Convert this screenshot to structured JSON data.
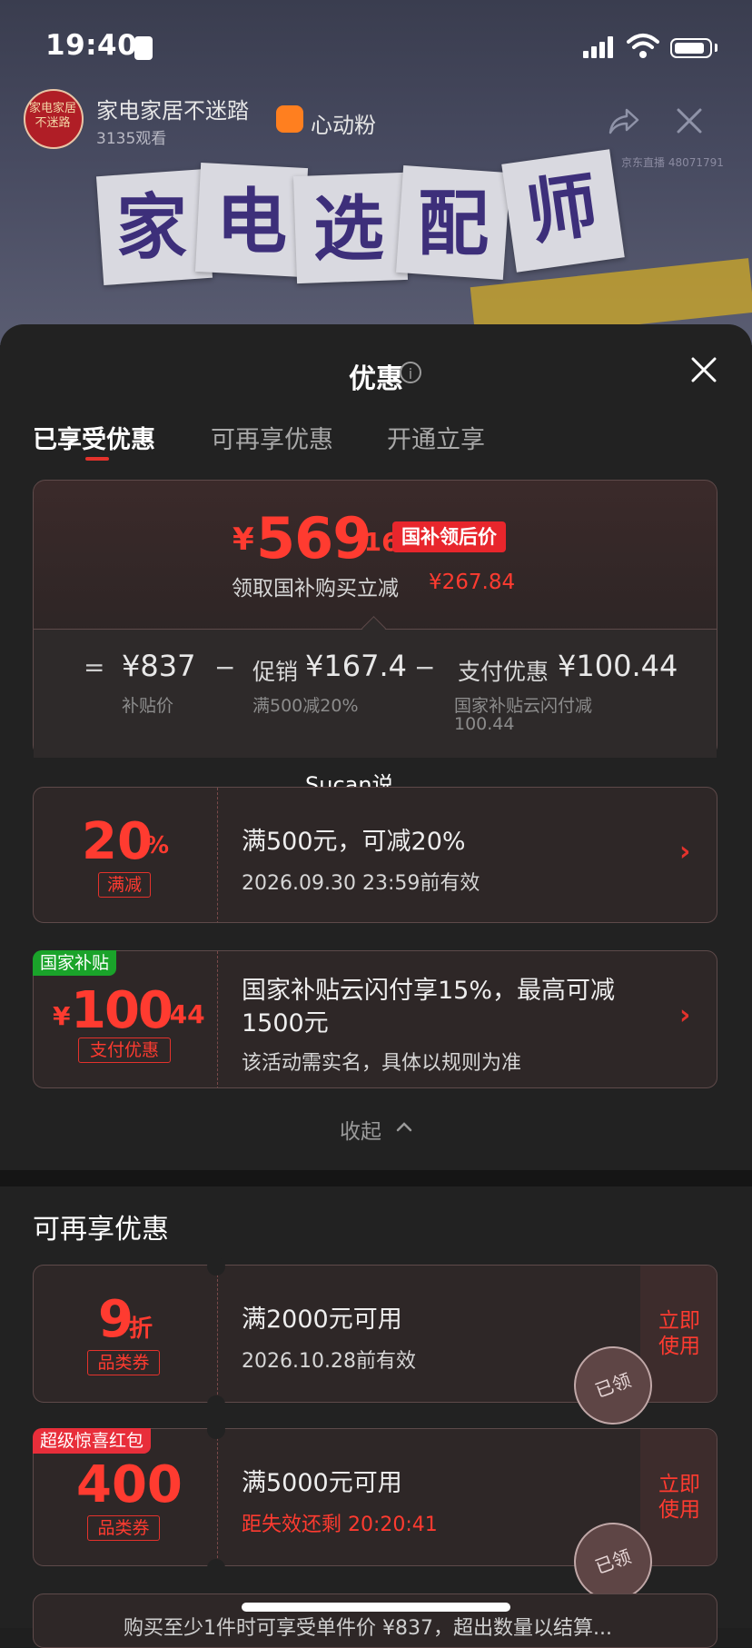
{
  "status_bar": {
    "time": "19:40"
  },
  "live": {
    "avatar_text": "家电家居\n不迷路",
    "name": "家电家居不迷踏",
    "views": "3135观看",
    "fans_label": "心动粉",
    "room_no": "京东直播 48071791",
    "banner_chars": [
      "家",
      "电",
      "选",
      "配",
      "师"
    ]
  },
  "sheet": {
    "title": "优惠",
    "tabs": [
      "已享受优惠",
      "可再享优惠",
      "开通立享"
    ],
    "active_tab": 0,
    "summary": {
      "price_yen": "¥",
      "price_int": "569",
      "price_dec": ".16",
      "badge": "国补领后价",
      "sub_label": "领取国补购买立减",
      "sub_amount": "¥267.84",
      "eq": "=",
      "minus1": "−",
      "minus2": "−",
      "base_value": "¥837",
      "base_label": "补贴价",
      "promo_title": "促销",
      "promo_value": "¥167.4",
      "promo_label": "满500减20%",
      "pay_title": "支付优惠",
      "pay_value": "¥100.44",
      "pay_label_1": "国家补贴云闪付减",
      "pay_label_2": "100.44"
    },
    "applied": [
      {
        "value": "20",
        "unit": "%",
        "tag": "满减",
        "line1": "满500元，可减20%",
        "line2": "2026.09.30 23:59前有效"
      },
      {
        "flag": "国家补贴",
        "yen": "¥",
        "value": "100",
        "dec": ".44",
        "tag": "支付优惠",
        "line1a": "国家补贴云闪付享15%，最高可减",
        "line1b": "1500元",
        "line2": "该活动需实名，具体以规则为准"
      }
    ],
    "collapse_label": "收起",
    "watermark": "Sucan说"
  },
  "more": {
    "title": "可再享优惠",
    "coupons": [
      {
        "value": "9",
        "unit": "折",
        "tag": "品类券",
        "line1": "满2000元可用",
        "line2": "2026.10.28前有效",
        "action": "立即\n使用",
        "stamp": "已领"
      },
      {
        "flag": "超级惊喜红包",
        "value": "400",
        "tag": "品类券",
        "line1": "满5000元可用",
        "line2": "距失效还剩 20:20:41",
        "action": "立即\n使用",
        "stamp": "已领"
      }
    ],
    "footer_text": "购买至少1件时可享受单件价 ¥837，超出数量以结算..."
  },
  "colors": {
    "accent": "#e4322c",
    "price_red": "#ff3b30",
    "flag_green": "#1aa32a",
    "sheet_bg": "#222222"
  }
}
